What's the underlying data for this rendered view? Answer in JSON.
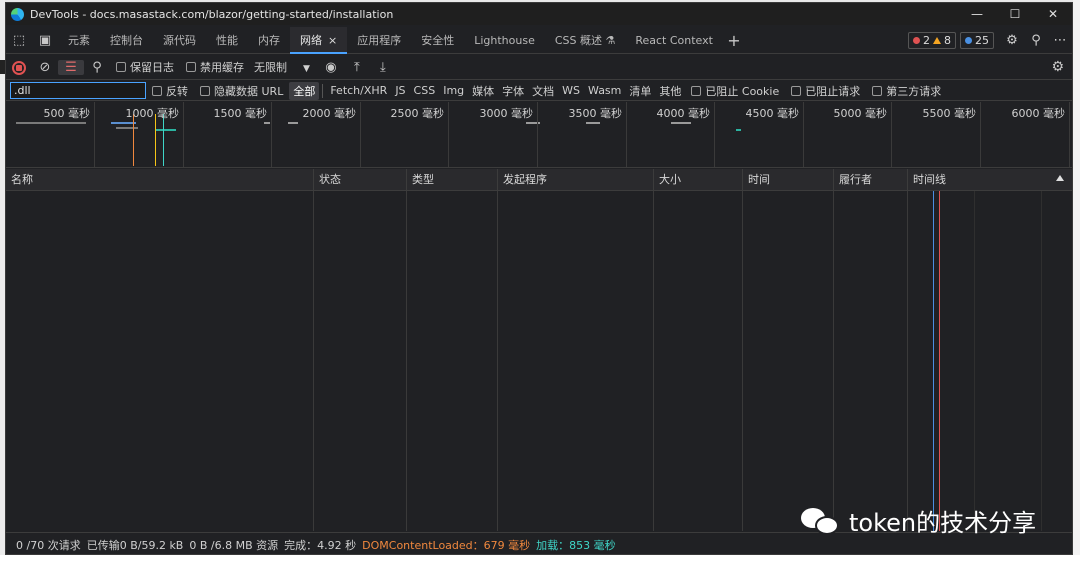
{
  "window": {
    "title": "DevTools - docs.masastack.com/blazor/getting-started/installation",
    "controls": [
      "—",
      "☐",
      "✕"
    ]
  },
  "tabs": [
    {
      "label": "元素"
    },
    {
      "label": "控制台"
    },
    {
      "label": "源代码"
    },
    {
      "label": "性能"
    },
    {
      "label": "内存"
    },
    {
      "label": "网络",
      "active": true
    },
    {
      "label": "应用程序"
    },
    {
      "label": "安全性"
    },
    {
      "label": "Lighthouse"
    },
    {
      "label": "CSS 概述 ⚗"
    },
    {
      "label": "React Context"
    }
  ],
  "issues": {
    "errors": "2",
    "warnings": "8",
    "info": "25"
  },
  "toolbar": {
    "preserve_log": "保留日志",
    "disable_cache": "禁用缓存",
    "throttle": "无限制"
  },
  "filter": {
    "value": ".dll",
    "invert": "反转",
    "hide_data_url": "隐藏数据 URL",
    "types": [
      "全部",
      "Fetch/XHR",
      "JS",
      "CSS",
      "Img",
      "媒体",
      "字体",
      "文档",
      "WS",
      "Wasm",
      "清单",
      "其他"
    ],
    "blocked_cookie": "已阻止 Cookie",
    "blocked_requests": "已阻止请求",
    "third_party": "第三方请求"
  },
  "overview": {
    "ticks": [
      "500 毫秒",
      "1000 毫秒",
      "1500 毫秒",
      "2000 毫秒",
      "2500 毫秒",
      "3000 毫秒",
      "3500 毫秒",
      "4000 毫秒",
      "4500 毫秒",
      "5000 毫秒",
      "5500 毫秒",
      "6000 毫秒"
    ]
  },
  "columns": [
    "名称",
    "状态",
    "类型",
    "发起程序",
    "大小",
    "时间",
    "履行者",
    "时间线"
  ],
  "status": {
    "requests": "0 /70 次请求",
    "transferred": "已传输0 B/59.2 kB",
    "resources": "0 B /6.8 MB 资源",
    "finish": "完成：4.92 秒",
    "dom_content_loaded": "DOMContentLoaded：679 毫秒",
    "load": "加载：853 毫秒"
  },
  "watermark": "token的技术分享",
  "colors": {
    "accent": "#4aa3ff",
    "dom": "#f0883e",
    "load": "#3fd6c8",
    "error": "#e05252"
  }
}
